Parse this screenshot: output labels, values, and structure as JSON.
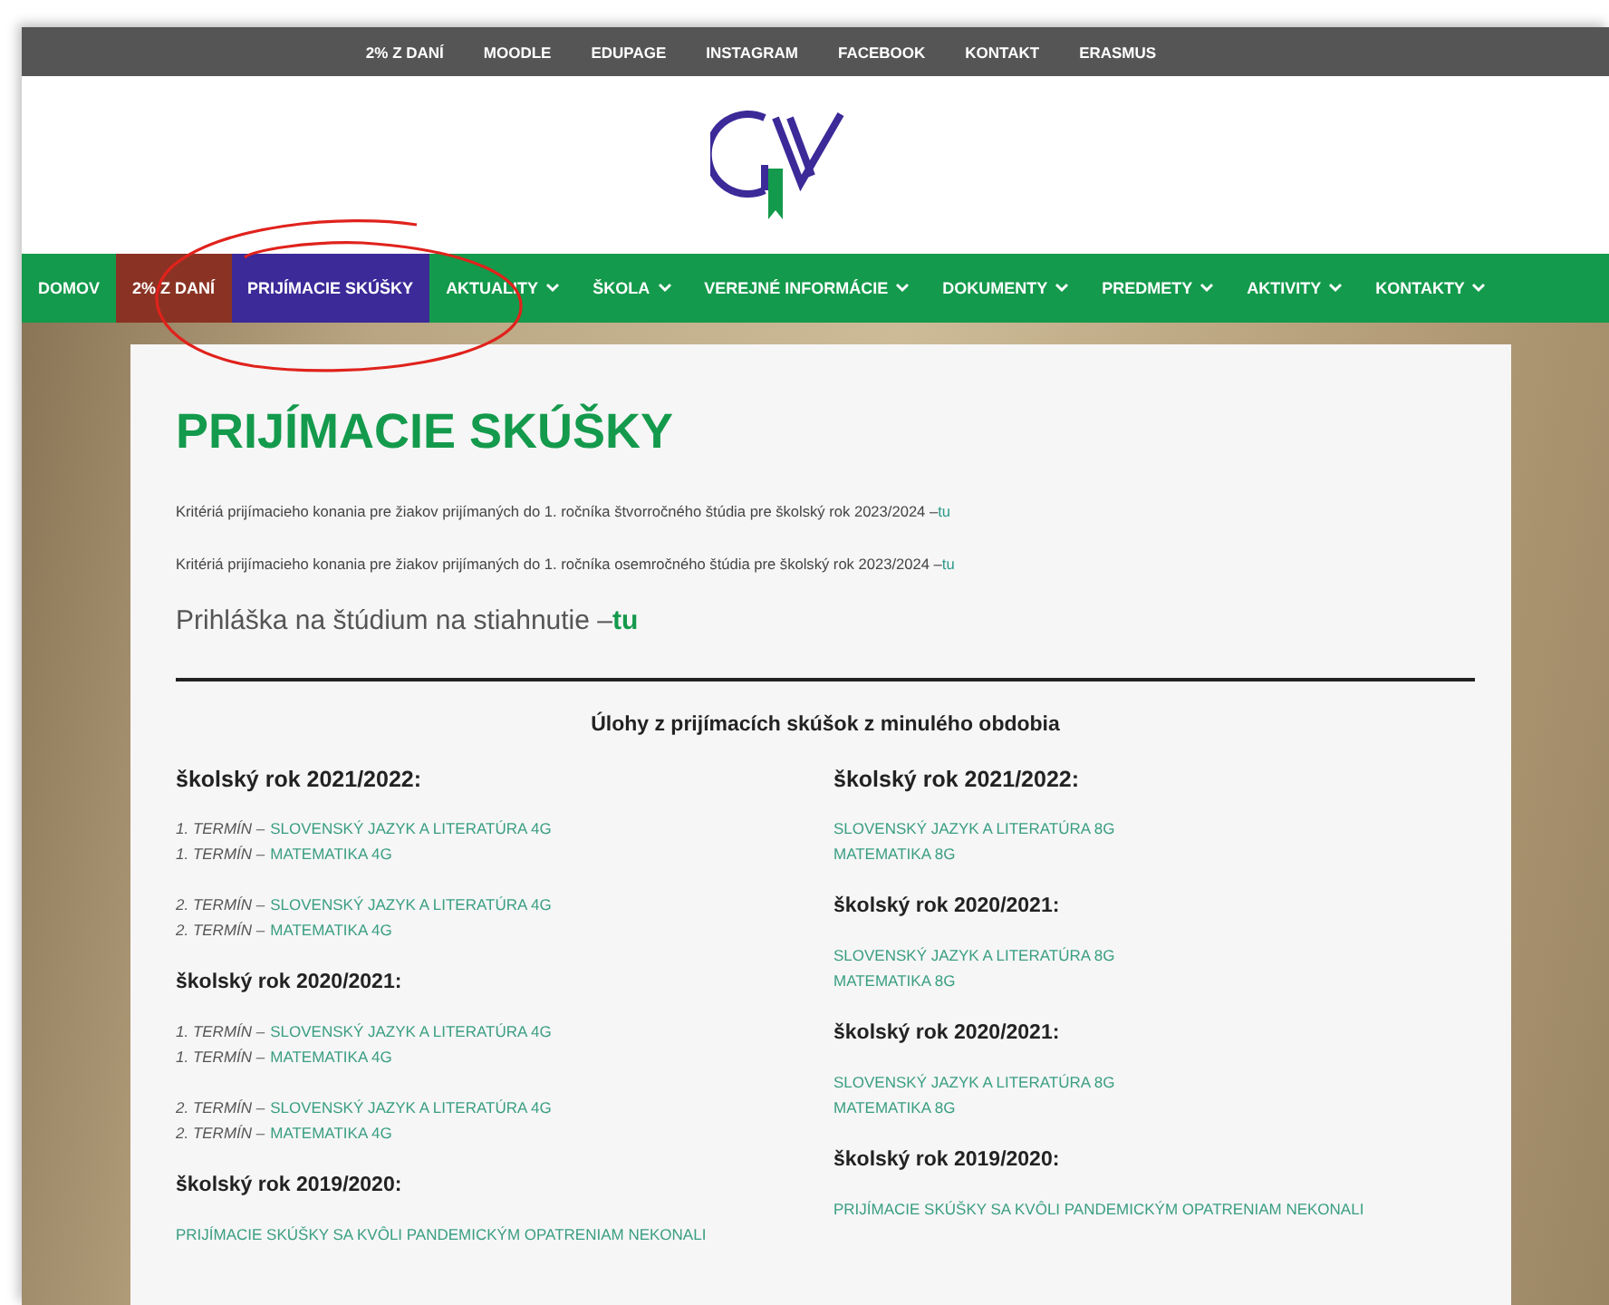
{
  "top_bar": {
    "links": [
      "2% Z DANÍ",
      "MOODLE",
      "EDUPAGE",
      "INSTAGRAM",
      "FACEBOOK",
      "KONTAKT",
      "ERASMUS"
    ]
  },
  "nav": {
    "items": [
      {
        "label": "DOMOV",
        "selected": false,
        "has_dropdown": false
      },
      {
        "label": "2% Z DANÍ",
        "selected": false,
        "has_dropdown": false,
        "color": "#8a3324"
      },
      {
        "label": "PRIJÍMACIE SKÚŠKY",
        "selected": true,
        "has_dropdown": false
      },
      {
        "label": "AKTUALITY",
        "selected": false,
        "has_dropdown": true
      },
      {
        "label": "ŠKOLA",
        "selected": false,
        "has_dropdown": true
      },
      {
        "label": "VEREJNÉ INFORMÁCIE",
        "selected": false,
        "has_dropdown": true
      },
      {
        "label": "DOKUMENTY",
        "selected": false,
        "has_dropdown": true
      },
      {
        "label": "PREDMETY",
        "selected": false,
        "has_dropdown": true
      },
      {
        "label": "AKTIVITY",
        "selected": false,
        "has_dropdown": true
      },
      {
        "label": "KONTAKTY",
        "selected": false,
        "has_dropdown": true
      }
    ]
  },
  "page": {
    "title": "PRIJÍMACIE SKÚŠKY",
    "intro_lines": [
      {
        "text": "Kritériá prijímacieho konania pre žiakov prijímaných do 1. ročníka štvorročného štúdia pre školský rok 2023/2024 –",
        "link": "tu"
      },
      {
        "text": "Kritériá prijímacieho konania pre žiakov prijímaných do 1. ročníka osemročného štúdia pre školský rok 2023/2024 –",
        "link": "tu"
      }
    ],
    "application": {
      "text": "Prihláška na štúdium na stiahnutie –",
      "link": "tu"
    },
    "section_heading": "Úlohy z prijímacích skúšok z minulého obdobia",
    "columns": [
      {
        "groups": [
          {
            "heading": "školský rok 2021/2022:",
            "blocks": [
              [
                {
                  "term": "1. TERMÍN –",
                  "link": "SLOVENSKÝ JAZYK A LITERATÚRA 4G"
                },
                {
                  "term": "1. TERMÍN –",
                  "link": "MATEMATIKA 4G"
                }
              ],
              [
                {
                  "term": "2. TERMÍN –",
                  "link": "SLOVENSKÝ JAZYK A LITERATÚRA 4G"
                },
                {
                  "term": "2. TERMÍN –",
                  "link": "MATEMATIKA 4G"
                }
              ]
            ]
          },
          {
            "heading": "školský rok 2020/2021:",
            "blocks": [
              [
                {
                  "term": "1. TERMÍN –",
                  "link": "SLOVENSKÝ JAZYK A LITERATÚRA 4G"
                },
                {
                  "term": "1. TERMÍN –",
                  "link": "MATEMATIKA 4G"
                }
              ],
              [
                {
                  "term": "2. TERMÍN –",
                  "link": "SLOVENSKÝ JAZYK A LITERATÚRA 4G"
                },
                {
                  "term": "2. TERMÍN –",
                  "link": "MATEMATIKA 4G"
                }
              ]
            ]
          },
          {
            "heading": "školský rok 2019/2020:",
            "blocks": [
              [
                {
                  "link": "PRIJÍMACIE SKÚŠKY SA KVÔLI PANDEMICKÝM OPATRENIAM NEKONALI"
                }
              ]
            ]
          }
        ]
      },
      {
        "groups": [
          {
            "heading": "školský rok 2021/2022:",
            "blocks": [
              [
                {
                  "link": "SLOVENSKÝ JAZYK A LITERATÚRA 8G"
                },
                {
                  "link": "MATEMATIKA 8G"
                }
              ]
            ]
          },
          {
            "heading": "školský rok 2020/2021:",
            "blocks": [
              [
                {
                  "link": "SLOVENSKÝ JAZYK A LITERATÚRA 8G"
                },
                {
                  "link": "MATEMATIKA 8G"
                }
              ]
            ]
          },
          {
            "heading": "školský rok 2020/2021:",
            "blocks": [
              [
                {
                  "link": "SLOVENSKÝ JAZYK A LITERATÚRA 8G"
                },
                {
                  "link": "MATEMATIKA 8G"
                }
              ]
            ]
          },
          {
            "heading": "školský rok 2019/2020:",
            "blocks": [
              [
                {
                  "link": "PRIJÍMACIE SKÚŠKY SA KVÔLI PANDEMICKÝM OPATRENIAM NEKONALI"
                }
              ]
            ]
          }
        ]
      }
    ]
  }
}
